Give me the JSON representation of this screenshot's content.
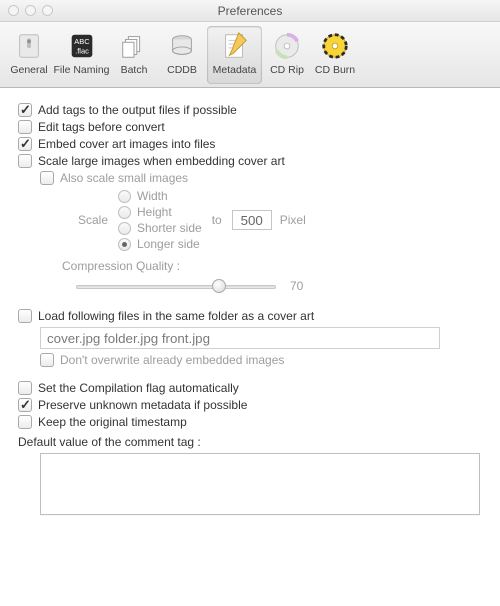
{
  "window": {
    "title": "Preferences"
  },
  "toolbar": {
    "items": [
      {
        "label": "General"
      },
      {
        "label": "File Naming"
      },
      {
        "label": "Batch"
      },
      {
        "label": "CDDB"
      },
      {
        "label": "Metadata"
      },
      {
        "label": "CD Rip"
      },
      {
        "label": "CD Burn"
      }
    ]
  },
  "opts": {
    "add_tags": "Add tags to the output files if possible",
    "edit_tags": "Edit tags before convert",
    "embed_cover": "Embed cover art images into files",
    "scale_large": "Scale large images when embedding cover art",
    "also_small": "Also scale small images",
    "scale_label": "Scale",
    "to_label": "to",
    "pixel_label": "Pixel",
    "scale_value": "500",
    "radios": {
      "width": "Width",
      "height": "Height",
      "shorter": "Shorter side",
      "longer": "Longer side"
    },
    "cq_label": "Compression Quality :",
    "cq_value": "70",
    "load_cover": "Load following files in the same folder as a cover art",
    "cover_files": "cover.jpg folder.jpg front.jpg",
    "dont_overwrite": "Don't overwrite already embedded images",
    "compilation": "Set the Compilation flag automatically",
    "preserve_meta": "Preserve unknown metadata if possible",
    "keep_ts": "Keep the original timestamp",
    "comment_label": "Default value of the comment tag :"
  },
  "checked": {
    "add_tags": true,
    "edit_tags": false,
    "embed_cover": true,
    "scale_large": false,
    "also_small": false,
    "load_cover": false,
    "dont_overwrite": false,
    "compilation": false,
    "preserve_meta": true,
    "keep_ts": false
  }
}
